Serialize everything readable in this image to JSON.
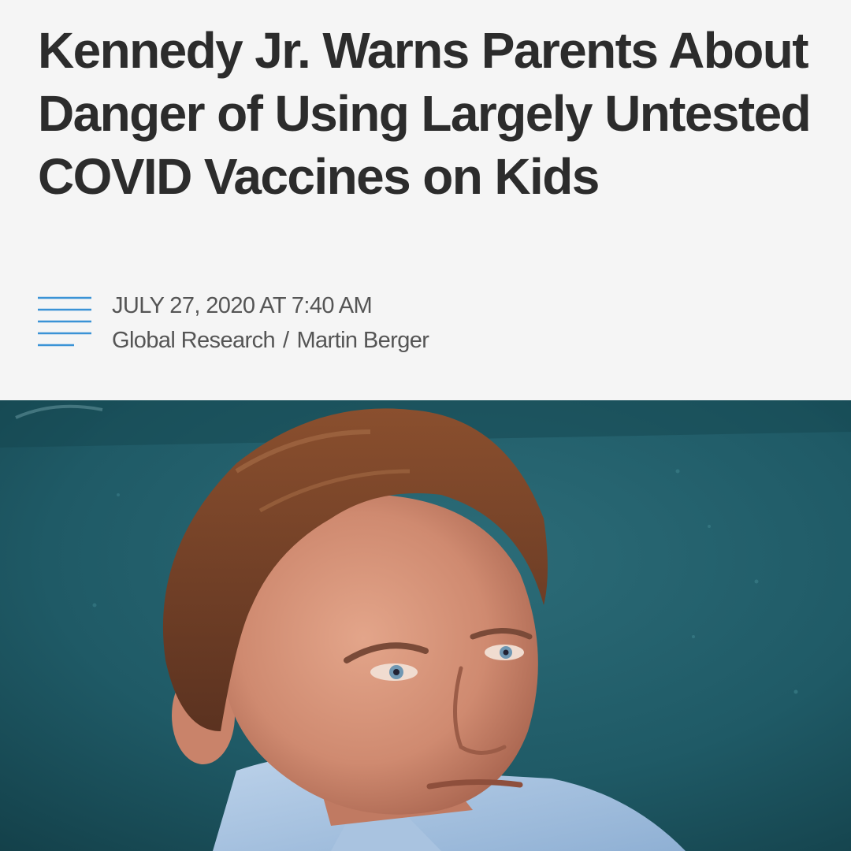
{
  "article": {
    "headline": "Kennedy Jr. Warns Parents About Danger of Using Largely Untested COVID Vaccines on Kids",
    "date": "JULY 27, 2020 AT 7:40 AM",
    "source": "Global Research",
    "separator": "/",
    "author": "Martin Berger",
    "meta_icon": "lines-icon"
  },
  "photo": {
    "subject": "man-portrait"
  },
  "colors": {
    "background": "#f5f5f5",
    "headline": "#2c2c2c",
    "meta_text": "#555555",
    "accent_lines": "#3a93d6",
    "photo_background": "#1d5762"
  }
}
